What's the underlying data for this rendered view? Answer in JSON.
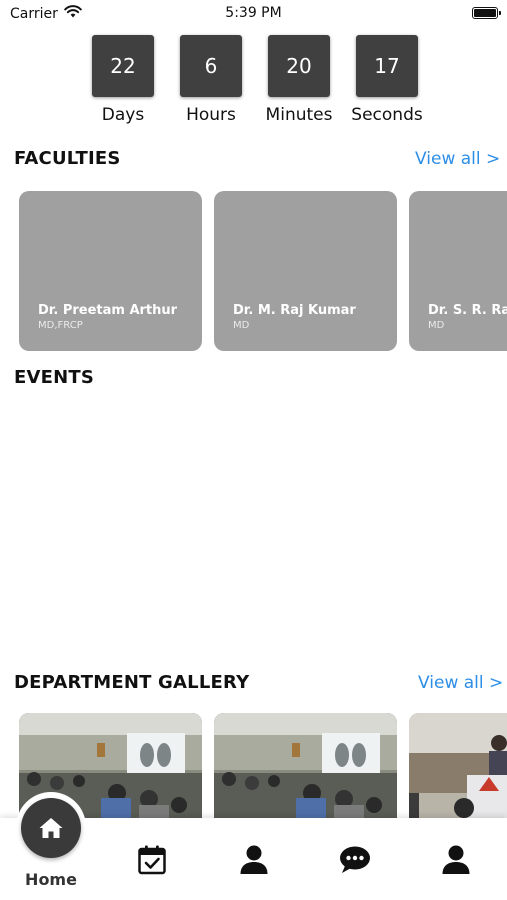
{
  "status_bar": {
    "carrier": "Carrier",
    "time": "5:39 PM"
  },
  "countdown": [
    {
      "value": "22",
      "label": "Days"
    },
    {
      "value": "6",
      "label": "Hours"
    },
    {
      "value": "20",
      "label": "Minutes"
    },
    {
      "value": "17",
      "label": "Seconds"
    }
  ],
  "faculties": {
    "title": "FACULTIES",
    "view_all": "View all >",
    "cards": [
      {
        "name": "Dr. Preetam Arthur",
        "degree": "MD,FRCP"
      },
      {
        "name": "Dr. M. Raj Kumar",
        "degree": "MD"
      },
      {
        "name": "Dr. S. R. Ra",
        "degree": "MD"
      }
    ]
  },
  "events": {
    "title": "EVENTS"
  },
  "gallery": {
    "title": "DEPARTMENT GALLERY",
    "view_all": "View all >"
  },
  "tab_bar": {
    "items": [
      {
        "icon": "home-icon",
        "label": "Home"
      },
      {
        "icon": "calendar-check-icon"
      },
      {
        "icon": "person-icon"
      },
      {
        "icon": "chat-bubble-icon"
      },
      {
        "icon": "person-icon"
      }
    ]
  },
  "colors": {
    "accent": "#2d8ee6",
    "countdown_box": "#404040",
    "card_placeholder": "#a0a0a0"
  }
}
